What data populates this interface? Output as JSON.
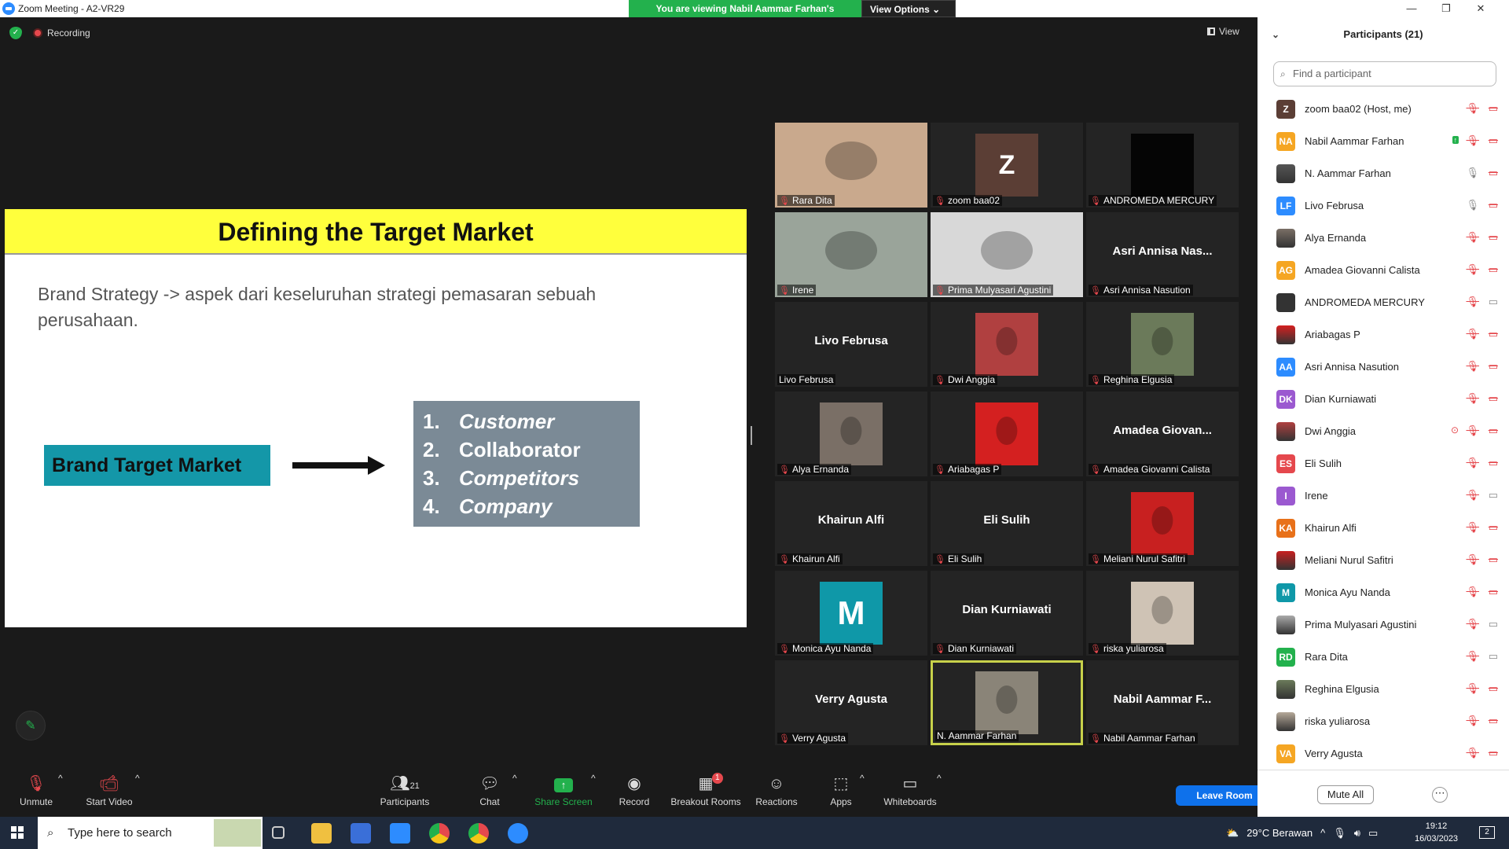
{
  "window": {
    "title": "Zoom Meeting - A2-VR29",
    "minimize": "—",
    "maximize": "❐",
    "close": "✕"
  },
  "banner": {
    "message": "You are viewing Nabil Aammar Farhan's screen",
    "view_options": "View Options"
  },
  "status": {
    "recording": "Recording",
    "view": "View"
  },
  "slide": {
    "title": "Defining the Target Market",
    "body": "Brand Strategy -> aspek dari keseluruhan strategi pemasaran sebuah perusahaan.",
    "box_label": "Brand Target Market",
    "list": [
      {
        "n": "1.",
        "t": "Customer"
      },
      {
        "n": "2.",
        "t": "Collaborator"
      },
      {
        "n": "3.",
        "t": "Competitors"
      },
      {
        "n": "4.",
        "t": "Company"
      }
    ],
    "colors": {
      "title_bg": "#ffff3c",
      "box_bg": "#1497a8",
      "list_bg": "#7b8a96"
    }
  },
  "tiles": [
    {
      "name": "Rara Dita",
      "big": "",
      "photo": "#c9a98d",
      "muted": true
    },
    {
      "name": "zoom baa02",
      "big": "",
      "avatar": "Z",
      "avatar_color": "#5b3e35",
      "muted": true
    },
    {
      "name": "ANDROMEDA MERCURY",
      "big": "",
      "photo": "#050505",
      "muted": true
    },
    {
      "name": "Irene",
      "big": "",
      "photo": "#9aa49a",
      "muted": true
    },
    {
      "name": "Prima Mulyasari Agustini",
      "big": "",
      "photo": "#d8d8d8",
      "muted": true
    },
    {
      "name": "Asri Annisa Nasution",
      "big": "Asri Annisa Nas...",
      "muted": true
    },
    {
      "name": "Livo Februsa",
      "big": "Livo Februsa",
      "muted": false
    },
    {
      "name": "Dwi Anggia",
      "big": "",
      "photo": "#b04040",
      "muted": true
    },
    {
      "name": "Reghina Elgusia",
      "big": "",
      "photo": "#6b7a5a",
      "muted": true
    },
    {
      "name": "Alya Ernanda",
      "big": "",
      "photo": "#7a6f66",
      "muted": true
    },
    {
      "name": "Ariabagas P",
      "big": "",
      "photo": "#d42020",
      "muted": true
    },
    {
      "name": "Amadea Giovanni Calista",
      "big": "Amadea Giovan...",
      "muted": true
    },
    {
      "name": "Khairun Alfi",
      "big": "Khairun Alfi",
      "muted": true
    },
    {
      "name": "Eli Sulih",
      "big": "Eli Sulih",
      "muted": true
    },
    {
      "name": "Meliani Nurul Safitri",
      "big": "",
      "photo": "#c82020",
      "muted": true
    },
    {
      "name": "Monica Ayu Nanda",
      "big": "",
      "avatar": "M",
      "avatar_color": "#0f98a8",
      "muted": true
    },
    {
      "name": "Dian Kurniawati",
      "big": "Dian Kurniawati",
      "muted": true
    },
    {
      "name": "riska yuliarosa",
      "big": "",
      "photo": "#cfc3b5",
      "muted": true
    },
    {
      "name": "Verry Agusta",
      "big": "Verry Agusta",
      "muted": true
    },
    {
      "name": "N. Aammar Farhan",
      "big": "",
      "photo": "#8a8478",
      "muted": false,
      "active": true
    },
    {
      "name": "Nabil Aammar Farhan",
      "big": "Nabil Aammar F...",
      "muted": true
    }
  ],
  "panel": {
    "title": "Participants (21)",
    "search_placeholder": "Find a participant",
    "mute_all": "Mute All",
    "more": "⋯",
    "participants": [
      {
        "name": "zoom baa02 (Host, me)",
        "initials": "Z",
        "color": "#5b3e35",
        "mic": "muted",
        "cam": "off"
      },
      {
        "name": "Nabil Aammar Farhan",
        "initials": "NA",
        "color": "#f5a623",
        "mic": "muted",
        "cam": "off",
        "share": true
      },
      {
        "name": "N. Aammar Farhan",
        "initials": "",
        "color": "#555555",
        "mic": "on",
        "cam": "off"
      },
      {
        "name": "Livo Februsa",
        "initials": "LF",
        "color": "#2d8cff",
        "mic": "on",
        "cam": "off"
      },
      {
        "name": "Alya Ernanda",
        "initials": "",
        "color": "#7a6f66",
        "mic": "muted",
        "cam": "off"
      },
      {
        "name": "Amadea Giovanni Calista",
        "initials": "AG",
        "color": "#f5a623",
        "mic": "muted",
        "cam": "off"
      },
      {
        "name": "ANDROMEDA MERCURY",
        "initials": "",
        "color": "#333333",
        "mic": "muted",
        "cam": "on"
      },
      {
        "name": "Ariabagas P",
        "initials": "",
        "color": "#d42020",
        "mic": "muted",
        "cam": "off"
      },
      {
        "name": "Asri Annisa Nasution",
        "initials": "AA",
        "color": "#2d8cff",
        "mic": "muted",
        "cam": "off"
      },
      {
        "name": "Dian Kurniawati",
        "initials": "DK",
        "color": "#9b59d0",
        "mic": "muted",
        "cam": "off"
      },
      {
        "name": "Dwi Anggia",
        "initials": "",
        "color": "#b04040",
        "mic": "muted",
        "cam": "off",
        "record": true
      },
      {
        "name": "Eli Sulih",
        "initials": "ES",
        "color": "#e5484d",
        "mic": "muted",
        "cam": "off"
      },
      {
        "name": "Irene",
        "initials": "I",
        "color": "#9b59d0",
        "mic": "muted",
        "cam": "on"
      },
      {
        "name": "Khairun Alfi",
        "initials": "KA",
        "color": "#e8711a",
        "mic": "muted",
        "cam": "off"
      },
      {
        "name": "Meliani Nurul Safitri",
        "initials": "",
        "color": "#c82020",
        "mic": "muted",
        "cam": "off"
      },
      {
        "name": "Monica Ayu Nanda",
        "initials": "M",
        "color": "#0f98a8",
        "mic": "muted",
        "cam": "off"
      },
      {
        "name": "Prima Mulyasari Agustini",
        "initials": "",
        "color": "#aaaaaa",
        "mic": "muted",
        "cam": "on"
      },
      {
        "name": "Rara Dita",
        "initials": "RD",
        "color": "#23b14d",
        "mic": "muted",
        "cam": "on"
      },
      {
        "name": "Reghina Elgusia",
        "initials": "",
        "color": "#6b7a5a",
        "mic": "muted",
        "cam": "off"
      },
      {
        "name": "riska yuliarosa",
        "initials": "",
        "color": "#b5a898",
        "mic": "muted",
        "cam": "off"
      },
      {
        "name": "Verry Agusta",
        "initials": "VA",
        "color": "#f5a623",
        "mic": "muted",
        "cam": "off"
      }
    ]
  },
  "toolbar": {
    "unmute": "Unmute",
    "start_video": "Start Video",
    "participants": "Participants",
    "participants_count": "21",
    "chat": "Chat",
    "share_screen": "Share Screen",
    "record": "Record",
    "breakout": "Breakout Rooms",
    "breakout_badge": "1",
    "reactions": "Reactions",
    "apps": "Apps",
    "whiteboards": "Whiteboards",
    "leave": "Leave Room"
  },
  "taskbar": {
    "search": "Type here to search",
    "weather": "29°C  Berawan",
    "time": "19:12",
    "date": "16/03/2023",
    "notif": "2"
  }
}
